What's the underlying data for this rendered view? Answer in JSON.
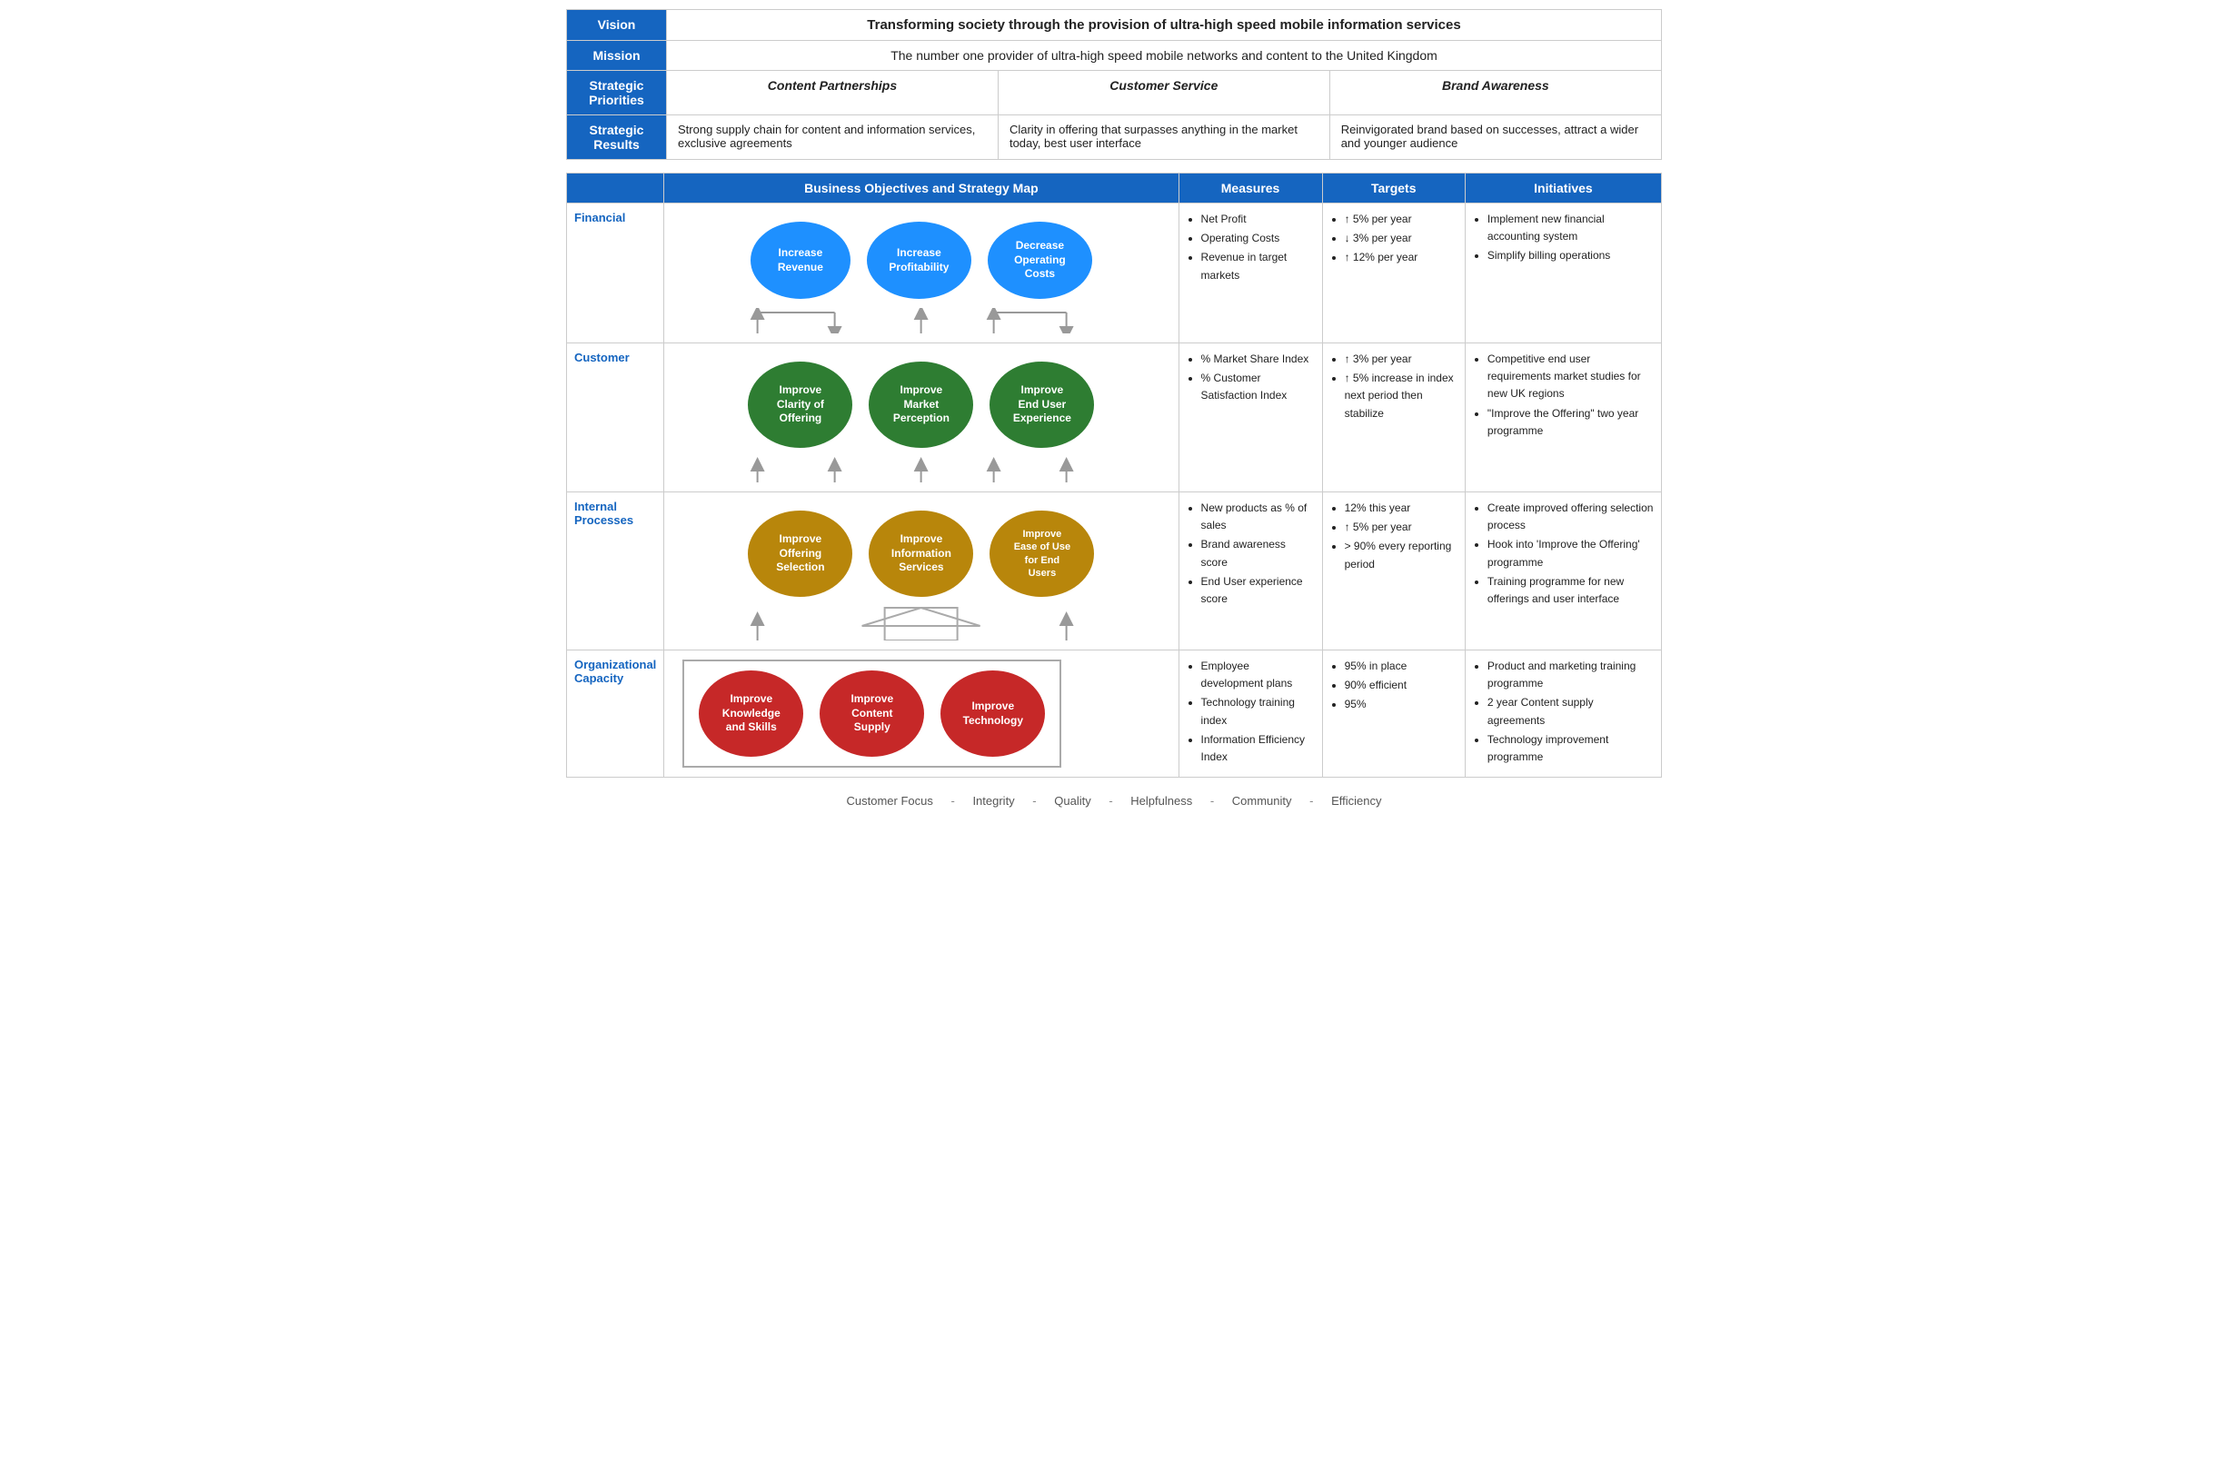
{
  "top": {
    "vision_label": "Vision",
    "vision_text": "Transforming society through the provision of ultra-high speed mobile information services",
    "mission_label": "Mission",
    "mission_text": "The number one provider of ultra-high speed mobile networks and content to the United Kingdom",
    "strategic_priorities_label": "Strategic\nPriorities",
    "priority1": "Content Partnerships",
    "priority2": "Customer Service",
    "priority3": "Brand Awareness",
    "strategic_results_label": "Strategic\nResults",
    "result1": "Strong supply chain for content and information services, exclusive agreements",
    "result2": "Clarity in offering that surpasses anything in the market today, best user interface",
    "result3": "Reinvigorated brand based on successes, attract a wider and younger audience"
  },
  "main_header": {
    "map_title": "Business Objectives and Strategy Map",
    "measures_title": "Measures",
    "targets_title": "Targets",
    "initiatives_title": "Initiatives"
  },
  "financial": {
    "label": "Financial",
    "nodes": [
      {
        "text": "Increase Revenue",
        "color": "blue"
      },
      {
        "text": "Increase Profitability",
        "color": "blue"
      },
      {
        "text": "Decrease Operating Costs",
        "color": "blue"
      }
    ],
    "measures": [
      "Net Profit",
      "Operating Costs",
      "Revenue in target markets"
    ],
    "targets": [
      "↑ 5% per year",
      "↓ 3% per year",
      "↑ 12% per year"
    ],
    "initiatives": [
      "Implement new financial accounting system",
      "Simplify billing operations"
    ]
  },
  "customer": {
    "label": "Customer",
    "nodes": [
      {
        "text": "Improve Clarity of Offering",
        "color": "green"
      },
      {
        "text": "Improve Market Perception",
        "color": "green"
      },
      {
        "text": "Improve End User Experience",
        "color": "green"
      }
    ],
    "measures": [
      "% Market Share Index",
      "% Customer Satisfaction Index"
    ],
    "targets": [
      "↑ 3% per year",
      "↑ 5% increase in index next period then stabilize"
    ],
    "initiatives": [
      "Competitive end user requirements market studies for new UK regions",
      "\"Improve the Offering\" two year programme"
    ]
  },
  "internal": {
    "label": "Internal\nProcesses",
    "nodes": [
      {
        "text": "Improve Offering Selection",
        "color": "gold"
      },
      {
        "text": "Improve Information Services",
        "color": "gold"
      },
      {
        "text": "Improve Ease of Use for End Users",
        "color": "gold"
      }
    ],
    "measures": [
      "New products as % of sales",
      "Brand awareness score",
      "End User experience score"
    ],
    "targets": [
      "12% this year",
      "↑ 5% per year",
      "> 90% every reporting period"
    ],
    "initiatives": [
      "Create improved offering selection process",
      "Hook into 'Improve the Offering' programme",
      "Training programme for new offerings and user interface"
    ]
  },
  "org": {
    "label": "Organizational\nCapacity",
    "nodes": [
      {
        "text": "Improve Knowledge and Skills",
        "color": "red"
      },
      {
        "text": "Improve Content Supply",
        "color": "red"
      },
      {
        "text": "Improve Technology",
        "color": "red"
      }
    ],
    "measures": [
      "Employee development plans",
      "Technology training index",
      "Information Efficiency Index"
    ],
    "targets": [
      "95% in place",
      "90% efficient",
      "95%"
    ],
    "initiatives": [
      "Product and marketing training programme",
      "2 year Content supply agreements",
      "Technology improvement programme"
    ]
  },
  "footer": {
    "values": [
      "Customer Focus",
      "Integrity",
      "Quality",
      "Helpfulness",
      "Community",
      "Efficiency"
    ]
  }
}
